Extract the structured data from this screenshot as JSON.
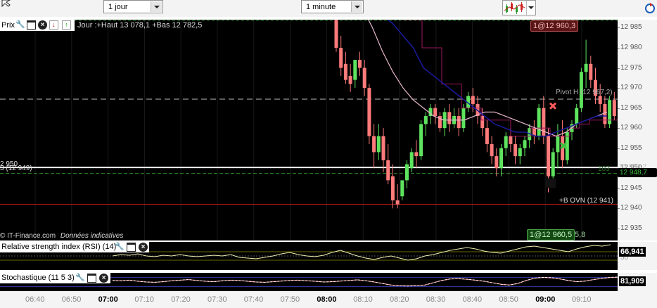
{
  "toolbar": {
    "period_select": "1 jour",
    "interval_select": "1 minute"
  },
  "price_panel": {
    "title": "Prix",
    "jour_info": "Jour :+Haut 13 078,1 +Bas 12 782,5",
    "y_ticks": [
      "12 985",
      "12 980",
      "12 975",
      "12 970",
      "12 965",
      "12 960",
      "12 955",
      "12 950",
      "12 945",
      "12 940",
      "12 935"
    ],
    "level_left_1": "2 950",
    "level_left_2": "3 (12 949)",
    "pivot_label": "Pivot H (12 967,2)",
    "ovn_label": "+B OVN (12 941)",
    "order_top": "1@12 960,3",
    "order_bottom": "1@12 960,5",
    "order_bottom_suffix": "5,8",
    "current_price": "12 948,7",
    "current_price_prev": "12 950,2",
    "faded_label": "103",
    "source": "© IT-Finance.com",
    "source_note": "Données indicatives"
  },
  "rsi_panel": {
    "title": "Relative strength index (RSI) (14)",
    "value": "66,941",
    "axis_hint": "50"
  },
  "stoch_panel": {
    "title": "Stochastique (11 5 3)",
    "value": "81,909"
  },
  "time_axis": [
    "06:40",
    "06:50",
    "07:00",
    "07:10",
    "07:20",
    "07:30",
    "07:40",
    "07:50",
    "08:00",
    "08:10",
    "08:20",
    "08:30",
    "08:40",
    "08:50",
    "09:00",
    "09:10"
  ],
  "time_axis_bold": [
    "07:00",
    "08:00",
    "09:00"
  ],
  "colors": {
    "up": "#5ee35e",
    "down": "#ff7b7b",
    "sma_fast": "#e8b8cf",
    "sma_slow": "#1a1a9e",
    "sma_step": "#a01660",
    "ovn_line": "#c01818",
    "level_green": "#2a8a2a"
  },
  "chart_data": {
    "type": "candlestick",
    "y_range": [
      12932,
      12987
    ],
    "candles": [
      {
        "o": 12987,
        "h": 12988,
        "c": 12980,
        "l": 12979
      },
      {
        "o": 12980,
        "h": 12983,
        "c": 12975,
        "l": 12973
      },
      {
        "o": 12976,
        "h": 12979,
        "c": 12972,
        "l": 12971
      },
      {
        "o": 12973,
        "h": 12976,
        "c": 12971,
        "l": 12969
      },
      {
        "o": 12972,
        "h": 12975,
        "c": 12977,
        "l": 12970
      },
      {
        "o": 12977,
        "h": 12979,
        "c": 12975,
        "l": 12973
      },
      {
        "o": 12975,
        "h": 12977,
        "c": 12970,
        "l": 12968
      },
      {
        "o": 12970,
        "h": 12971,
        "c": 12958,
        "l": 12956
      },
      {
        "o": 12958,
        "h": 12961,
        "c": 12954,
        "l": 12950
      },
      {
        "o": 12954,
        "h": 12961,
        "c": 12958,
        "l": 12952
      },
      {
        "o": 12958,
        "h": 12960,
        "c": 12952,
        "l": 12949
      },
      {
        "o": 12952,
        "h": 12956,
        "c": 12947,
        "l": 12946
      },
      {
        "o": 12948,
        "h": 12951,
        "c": 12942,
        "l": 12940
      },
      {
        "o": 12942,
        "h": 12946,
        "c": 12941,
        "l": 12940
      },
      {
        "o": 12943,
        "h": 12946,
        "c": 12947,
        "l": 12942
      },
      {
        "o": 12947,
        "h": 12952,
        "c": 12951,
        "l": 12945
      },
      {
        "o": 12950,
        "h": 12955,
        "c": 12954,
        "l": 12949
      },
      {
        "o": 12954,
        "h": 12957,
        "c": 12953,
        "l": 12950
      },
      {
        "o": 12953,
        "h": 12962,
        "c": 12961,
        "l": 12952
      },
      {
        "o": 12961,
        "h": 12964,
        "c": 12963,
        "l": 12958
      },
      {
        "o": 12963,
        "h": 12966,
        "c": 12965,
        "l": 12961
      },
      {
        "o": 12965,
        "h": 12966,
        "c": 12963,
        "l": 12961
      },
      {
        "o": 12963,
        "h": 12964,
        "c": 12960,
        "l": 12959
      },
      {
        "o": 12960,
        "h": 12965,
        "c": 12964,
        "l": 12958
      },
      {
        "o": 12964,
        "h": 12966,
        "c": 12961,
        "l": 12959
      },
      {
        "o": 12961,
        "h": 12965,
        "c": 12963,
        "l": 12960
      },
      {
        "o": 12963,
        "h": 12965,
        "c": 12960,
        "l": 12958
      },
      {
        "o": 12960,
        "h": 12966,
        "c": 12965,
        "l": 12959
      },
      {
        "o": 12965,
        "h": 12969,
        "c": 12968,
        "l": 12964
      },
      {
        "o": 12968,
        "h": 12970,
        "c": 12966,
        "l": 12964
      },
      {
        "o": 12966,
        "h": 12968,
        "c": 12963,
        "l": 12961
      },
      {
        "o": 12963,
        "h": 12965,
        "c": 12960,
        "l": 12958
      },
      {
        "o": 12960,
        "h": 12962,
        "c": 12956,
        "l": 12954
      },
      {
        "o": 12956,
        "h": 12958,
        "c": 12953,
        "l": 12951
      },
      {
        "o": 12953,
        "h": 12955,
        "c": 12950,
        "l": 12948
      },
      {
        "o": 12950,
        "h": 12956,
        "c": 12955,
        "l": 12948
      },
      {
        "o": 12955,
        "h": 12959,
        "c": 12958,
        "l": 12953
      },
      {
        "o": 12958,
        "h": 12960,
        "c": 12956,
        "l": 12954
      },
      {
        "o": 12956,
        "h": 12958,
        "c": 12953,
        "l": 12951
      },
      {
        "o": 12953,
        "h": 12956,
        "c": 12955,
        "l": 12951
      },
      {
        "o": 12955,
        "h": 12958,
        "c": 12957,
        "l": 12953
      },
      {
        "o": 12957,
        "h": 12961,
        "c": 12960,
        "l": 12955
      },
      {
        "o": 12960,
        "h": 12962,
        "c": 12958,
        "l": 12956
      },
      {
        "o": 12958,
        "h": 12966,
        "c": 12965,
        "l": 12957
      },
      {
        "o": 12965,
        "h": 12968,
        "c": 12958,
        "l": 12956
      },
      {
        "o": 12958,
        "h": 12960,
        "c": 12948,
        "l": 12944
      },
      {
        "o": 12948,
        "h": 12955,
        "c": 12954,
        "l": 12946
      },
      {
        "o": 12954,
        "h": 12961,
        "c": 12958,
        "l": 12950
      },
      {
        "o": 12958,
        "h": 12962,
        "c": 12952,
        "l": 12950
      },
      {
        "o": 12952,
        "h": 12960,
        "c": 12959,
        "l": 12951
      },
      {
        "o": 12959,
        "h": 12962,
        "c": 12961,
        "l": 12957
      },
      {
        "o": 12961,
        "h": 12966,
        "c": 12965,
        "l": 12960
      },
      {
        "o": 12965,
        "h": 12975,
        "c": 12974,
        "l": 12964
      },
      {
        "o": 12974,
        "h": 12982,
        "c": 12976,
        "l": 12970
      },
      {
        "o": 12976,
        "h": 12978,
        "c": 12972,
        "l": 12970
      },
      {
        "o": 12972,
        "h": 12975,
        "c": 12968,
        "l": 12966
      },
      {
        "o": 12968,
        "h": 12971,
        "c": 12966,
        "l": 12964
      },
      {
        "o": 12966,
        "h": 12968,
        "c": 12961,
        "l": 12960
      },
      {
        "o": 12961,
        "h": 12968,
        "c": 12967,
        "l": 12960
      },
      {
        "o": 12967,
        "h": 12969,
        "c": 12963,
        "l": 12962
      }
    ],
    "sma_fast": [
      12990,
      12985,
      12979,
      12974,
      12970,
      12967,
      12965,
      12963,
      12962,
      12962,
      12962,
      12963,
      12964,
      12964,
      12963,
      12962,
      12961,
      12960,
      12959,
      12958,
      12959,
      12961,
      12962,
      12963,
      12964
    ],
    "sma_slow": [
      12990,
      12988,
      12986,
      12984,
      12981,
      12978,
      12975,
      12973,
      12971,
      12969,
      12967,
      12965,
      12963,
      12961,
      12960,
      12959,
      12959,
      12958,
      12958,
      12959,
      12960,
      12961,
      12962,
      12963,
      12963
    ],
    "rsi": [
      50,
      52,
      51,
      53,
      50,
      49,
      51,
      50,
      52,
      50,
      49,
      50,
      51,
      50,
      52,
      48,
      47,
      46,
      48,
      50,
      53,
      55,
      52,
      50,
      49,
      51,
      55,
      58,
      54,
      50,
      47,
      45,
      48,
      50,
      47,
      44,
      46,
      50,
      52,
      55,
      58,
      60,
      62,
      60,
      57,
      55,
      54,
      57,
      60,
      63,
      64,
      62,
      60,
      58,
      56,
      60,
      63,
      65,
      64,
      66
    ],
    "stoch": [
      60,
      58,
      62,
      55,
      50,
      48,
      52,
      58,
      62,
      66,
      60,
      55,
      52,
      58,
      62,
      60,
      55,
      50,
      48,
      52,
      56,
      60,
      62,
      58,
      55,
      50,
      52,
      56,
      60,
      64,
      58,
      50,
      40,
      30,
      25,
      24,
      26,
      30,
      45,
      60,
      70,
      72,
      68,
      62,
      55,
      45,
      35,
      30,
      40,
      60,
      75,
      80,
      78,
      70,
      60,
      52,
      56,
      66,
      74,
      80,
      82
    ]
  }
}
